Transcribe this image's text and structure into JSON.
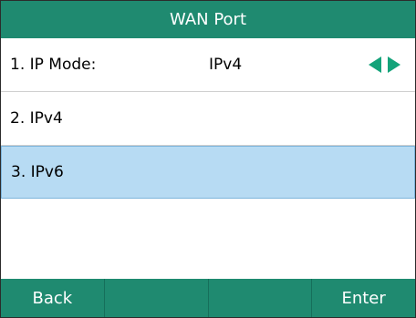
{
  "title": "WAN Port",
  "items": [
    {
      "label": "1. IP Mode:",
      "value": "IPv4"
    },
    {
      "label": "2. IPv4"
    },
    {
      "label": "3. IPv6"
    }
  ],
  "softkeys": [
    "Back",
    "",
    "",
    "Enter"
  ],
  "colors": {
    "header": "#1f8a70",
    "selected": "#b7dbf3",
    "arrow": "#14a37a"
  }
}
